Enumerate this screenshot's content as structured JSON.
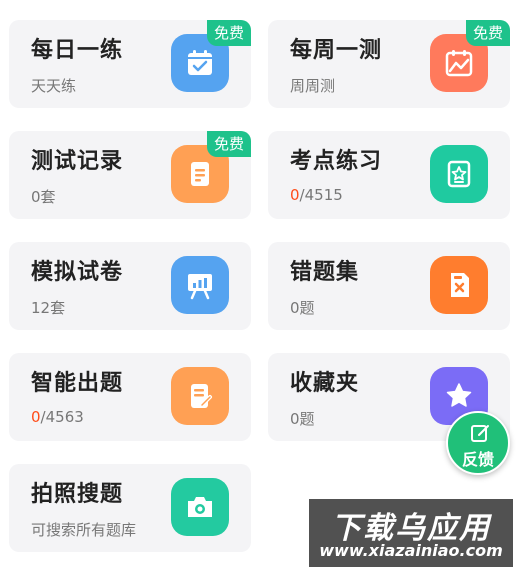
{
  "cards": [
    {
      "title": "每日一练",
      "sub": "天天练",
      "badge": "免费",
      "icon": "calendar-check-icon",
      "color": "#55a3f0"
    },
    {
      "title": "每周一测",
      "sub": "周周测",
      "badge": "免费",
      "icon": "calendar-chart-icon",
      "color": "#ff7a5c"
    },
    {
      "title": "测试记录",
      "sub": "0套",
      "badge": "免费",
      "icon": "document-list-icon",
      "color": "#ffa054"
    },
    {
      "title": "考点练习",
      "sub_highlight": "0",
      "sub_rest": "/4515",
      "icon": "star-book-icon",
      "color": "#1fcaa0"
    },
    {
      "title": "模拟试卷",
      "sub": "12套",
      "icon": "presentation-board-icon",
      "color": "#55a3f0"
    },
    {
      "title": "错题集",
      "sub": "0题",
      "icon": "error-file-icon",
      "color": "#ff7d2e"
    },
    {
      "title": "智能出题",
      "sub_highlight": "0",
      "sub_rest": "/4563",
      "icon": "document-edit-icon",
      "color": "#ffa054"
    },
    {
      "title": "收藏夹",
      "sub": "0题",
      "icon": "star-icon",
      "color": "#7b6cf6"
    },
    {
      "title": "拍照搜题",
      "sub": "可搜索所有题库",
      "icon": "camera-icon",
      "color": "#23caa0"
    }
  ],
  "feedback": {
    "label": "反馈",
    "icon": "edit-icon",
    "color": "#20c079"
  },
  "watermark": {
    "logo": "下载乌应用",
    "url": "www.xiazainiao.com"
  }
}
